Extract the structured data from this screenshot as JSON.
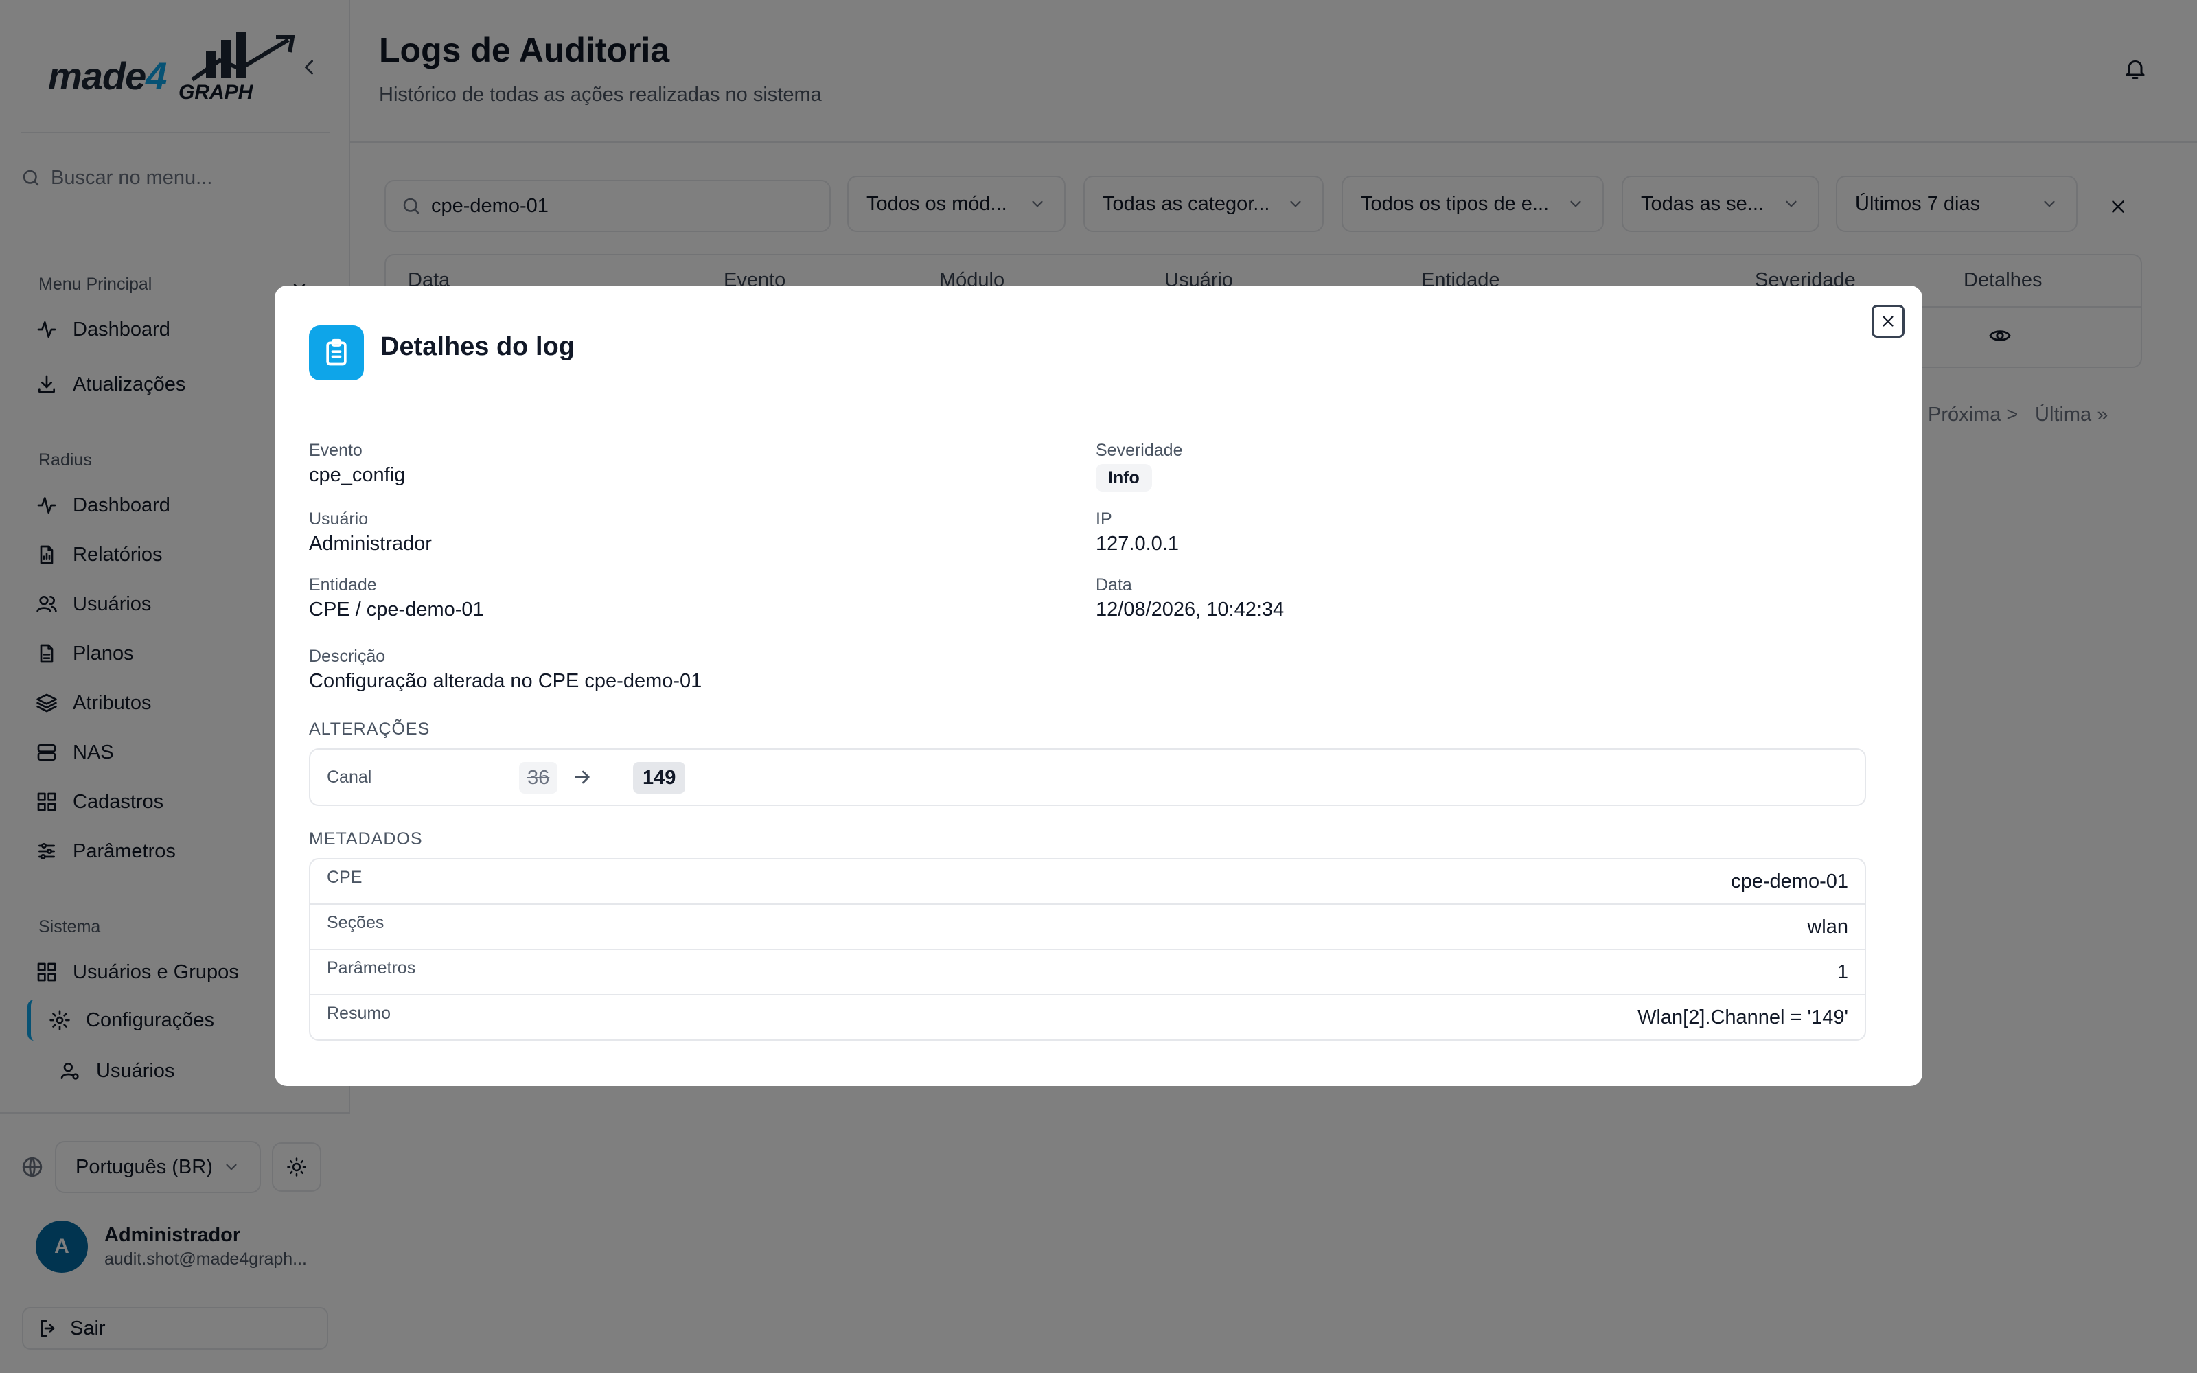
{
  "sidebar": {
    "logo": {
      "text_a": "made",
      "text_b": "4",
      "text_c": "GRAPH"
    },
    "search_placeholder": "Buscar no menu...",
    "sections": [
      {
        "title": "Menu Principal",
        "items": [
          "Dashboard",
          "Atualizações"
        ]
      },
      {
        "title": "Radius",
        "items": [
          "Dashboard",
          "Relatórios",
          "Usuários",
          "Planos",
          "Atributos",
          "NAS",
          "Cadastros",
          "Parâmetros"
        ]
      },
      {
        "title": "Sistema",
        "items": [
          "Usuários e Grupos",
          "Configurações",
          "Usuários"
        ]
      }
    ],
    "language": "Português (BR)",
    "user": {
      "initial": "A",
      "name": "Administrador",
      "email": "audit.shot@made4graph..."
    },
    "logout": "Sair"
  },
  "header": {
    "title": "Logs de Auditoria",
    "subtitle": "Histórico de todas as ações realizadas no sistema"
  },
  "filters": {
    "search_value": "cpe-demo-01",
    "module": "Todos os mód...",
    "category": "Todas as categor...",
    "event_type": "Todos os tipos de e...",
    "severity": "Todas as se...",
    "period": "Últimos 7 dias"
  },
  "table": {
    "columns": [
      "Data",
      "Evento",
      "Módulo",
      "Usuário",
      "Entidade",
      "Severidade",
      "Detalhes"
    ]
  },
  "pagination": {
    "next": "Próxima >",
    "last": "Última »"
  },
  "modal": {
    "title": "Detalhes do log",
    "fields": {
      "event_label": "Evento",
      "event_value": "cpe_config",
      "severity_label": "Severidade",
      "severity_value": "Info",
      "user_label": "Usuário",
      "user_value": "Administrador",
      "ip_label": "IP",
      "ip_value": "127.0.0.1",
      "entity_label": "Entidade",
      "entity_value": "CPE / cpe-demo-01",
      "date_label": "Data",
      "date_value": "12/08/2026, 10:42:34",
      "description_label": "Descrição",
      "description_value": "Configuração alterada no CPE cpe-demo-01"
    },
    "changes_title": "ALTERAÇÕES",
    "changes": [
      {
        "key": "Canal",
        "old": "36",
        "new": "149"
      }
    ],
    "metadata_title": "METADADOS",
    "metadata": [
      {
        "key": "CPE",
        "value": "cpe-demo-01"
      },
      {
        "key": "Seções",
        "value": "wlan"
      },
      {
        "key": "Parâmetros",
        "value": "1"
      },
      {
        "key": "Resumo",
        "value": "Wlan[2].Channel = '149'"
      }
    ]
  },
  "colors": {
    "accent": "#0ea5e9",
    "avatar": "#0369a1",
    "overlay": "rgba(0,0,0,0.5)"
  }
}
